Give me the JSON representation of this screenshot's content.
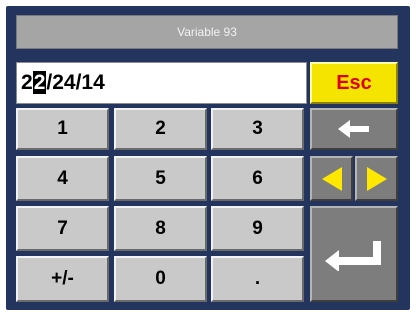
{
  "title": "Variable 93",
  "display": {
    "before_cursor": "2",
    "cursor_char": "2",
    "after_cursor": "/24/14"
  },
  "keys": {
    "k1": "1",
    "k2": "2",
    "k3": "3",
    "k4": "4",
    "k5": "5",
    "k6": "6",
    "k7": "7",
    "k8": "8",
    "k9": "9",
    "plusminus": "+/-",
    "k0": "0",
    "dot": ".",
    "esc": "Esc"
  },
  "icons": {
    "backspace": "left-arrow-icon",
    "cursor_left": "triangle-left-icon",
    "cursor_right": "triangle-right-icon",
    "enter": "enter-icon"
  },
  "colors": {
    "frame": "#23355f",
    "key": "#c9c9c9",
    "key_dark": "#7d7d7d",
    "esc_bg": "#f5e400",
    "esc_text": "#e10000",
    "arrow_yellow": "#ffe800"
  }
}
